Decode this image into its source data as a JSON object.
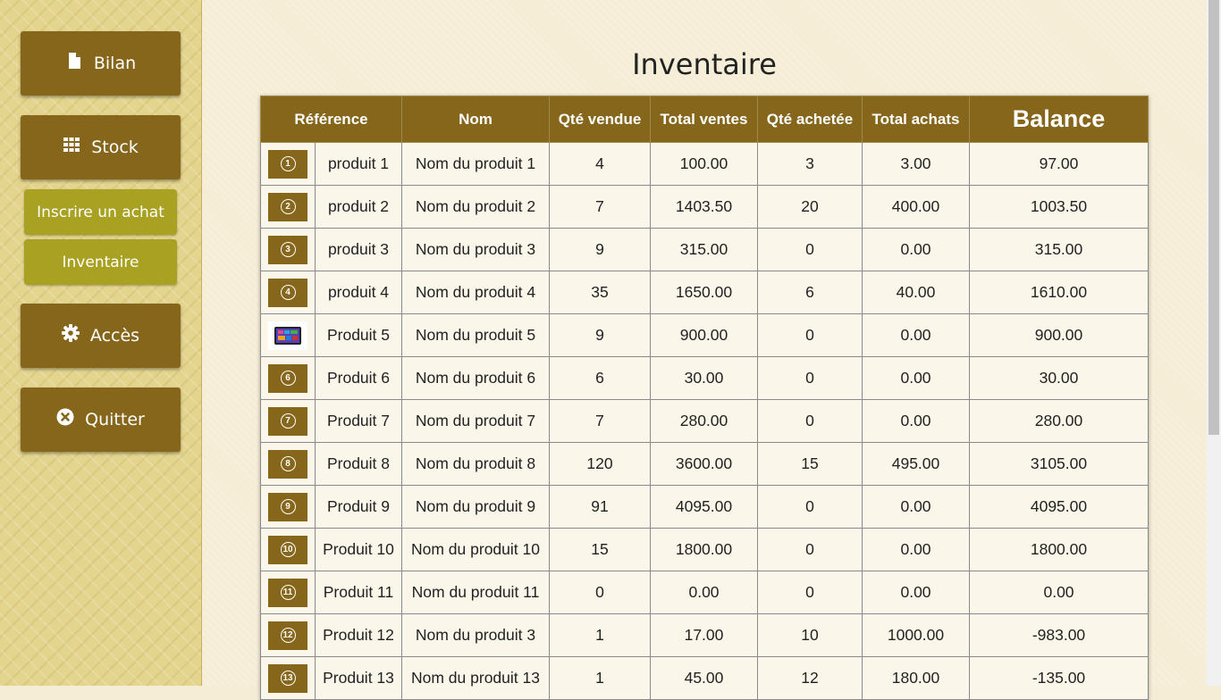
{
  "sidebar": {
    "items": [
      {
        "label": "Bilan",
        "icon": "file-icon"
      },
      {
        "label": "Stock",
        "icon": "grid-icon"
      },
      {
        "label": "Inscrire un achat"
      },
      {
        "label": "Inventaire"
      },
      {
        "label": "Accès",
        "icon": "gear-icon"
      },
      {
        "label": "Quitter",
        "icon": "close-circle-icon"
      }
    ]
  },
  "page": {
    "title": "Inventaire"
  },
  "table": {
    "headers": [
      "Référence",
      "Nom",
      "Qté vendue",
      "Total ventes",
      "Qté achetée",
      "Total achats",
      "Balance"
    ],
    "rows": [
      {
        "thumb": "1",
        "ref": "produit 1",
        "nom": "Nom du produit 1",
        "qv": "4",
        "tv": "100.00",
        "qa": "3",
        "ta": "3.00",
        "bal": "97.00"
      },
      {
        "thumb": "2",
        "ref": "produit 2",
        "nom": "Nom du produit 2",
        "qv": "7",
        "tv": "1403.50",
        "qa": "20",
        "ta": "400.00",
        "bal": "1003.50"
      },
      {
        "thumb": "3",
        "ref": "produit 3",
        "nom": "Nom du produit 3",
        "qv": "9",
        "tv": "315.00",
        "qa": "0",
        "ta": "0.00",
        "bal": "315.00"
      },
      {
        "thumb": "4",
        "ref": "produit 4",
        "nom": "Nom du produit 4",
        "qv": "35",
        "tv": "1650.00",
        "qa": "6",
        "ta": "40.00",
        "bal": "1610.00"
      },
      {
        "thumb": "tablet",
        "ref": "Produit 5",
        "nom": "Nom du produit 5",
        "qv": "9",
        "tv": "900.00",
        "qa": "0",
        "ta": "0.00",
        "bal": "900.00"
      },
      {
        "thumb": "6",
        "ref": "Produit 6",
        "nom": "Nom du produit 6",
        "qv": "6",
        "tv": "30.00",
        "qa": "0",
        "ta": "0.00",
        "bal": "30.00"
      },
      {
        "thumb": "7",
        "ref": "Produit 7",
        "nom": "Nom du produit 7",
        "qv": "7",
        "tv": "280.00",
        "qa": "0",
        "ta": "0.00",
        "bal": "280.00"
      },
      {
        "thumb": "8",
        "ref": "Produit 8",
        "nom": "Nom du produit 8",
        "qv": "120",
        "tv": "3600.00",
        "qa": "15",
        "ta": "495.00",
        "bal": "3105.00"
      },
      {
        "thumb": "9",
        "ref": "Produit 9",
        "nom": "Nom du produit 9",
        "qv": "91",
        "tv": "4095.00",
        "qa": "0",
        "ta": "0.00",
        "bal": "4095.00"
      },
      {
        "thumb": "10",
        "ref": "Produit 10",
        "nom": "Nom du produit 10",
        "qv": "15",
        "tv": "1800.00",
        "qa": "0",
        "ta": "0.00",
        "bal": "1800.00"
      },
      {
        "thumb": "11",
        "ref": "Produit 11",
        "nom": "Nom du produit 11",
        "qv": "0",
        "tv": "0.00",
        "qa": "0",
        "ta": "0.00",
        "bal": "0.00"
      },
      {
        "thumb": "12",
        "ref": "Produit 12",
        "nom": "Nom du produit 3",
        "qv": "1",
        "tv": "17.00",
        "qa": "10",
        "ta": "1000.00",
        "bal": "-983.00"
      },
      {
        "thumb": "13",
        "ref": "Produit 13",
        "nom": "Nom du produit 13",
        "qv": "1",
        "tv": "45.00",
        "qa": "12",
        "ta": "180.00",
        "bal": "-135.00"
      }
    ]
  },
  "colors": {
    "button": "#85661b",
    "submenu": "#a8a121",
    "sidebar_bg": "#e3d48e",
    "main_bg": "#f5edd6"
  }
}
